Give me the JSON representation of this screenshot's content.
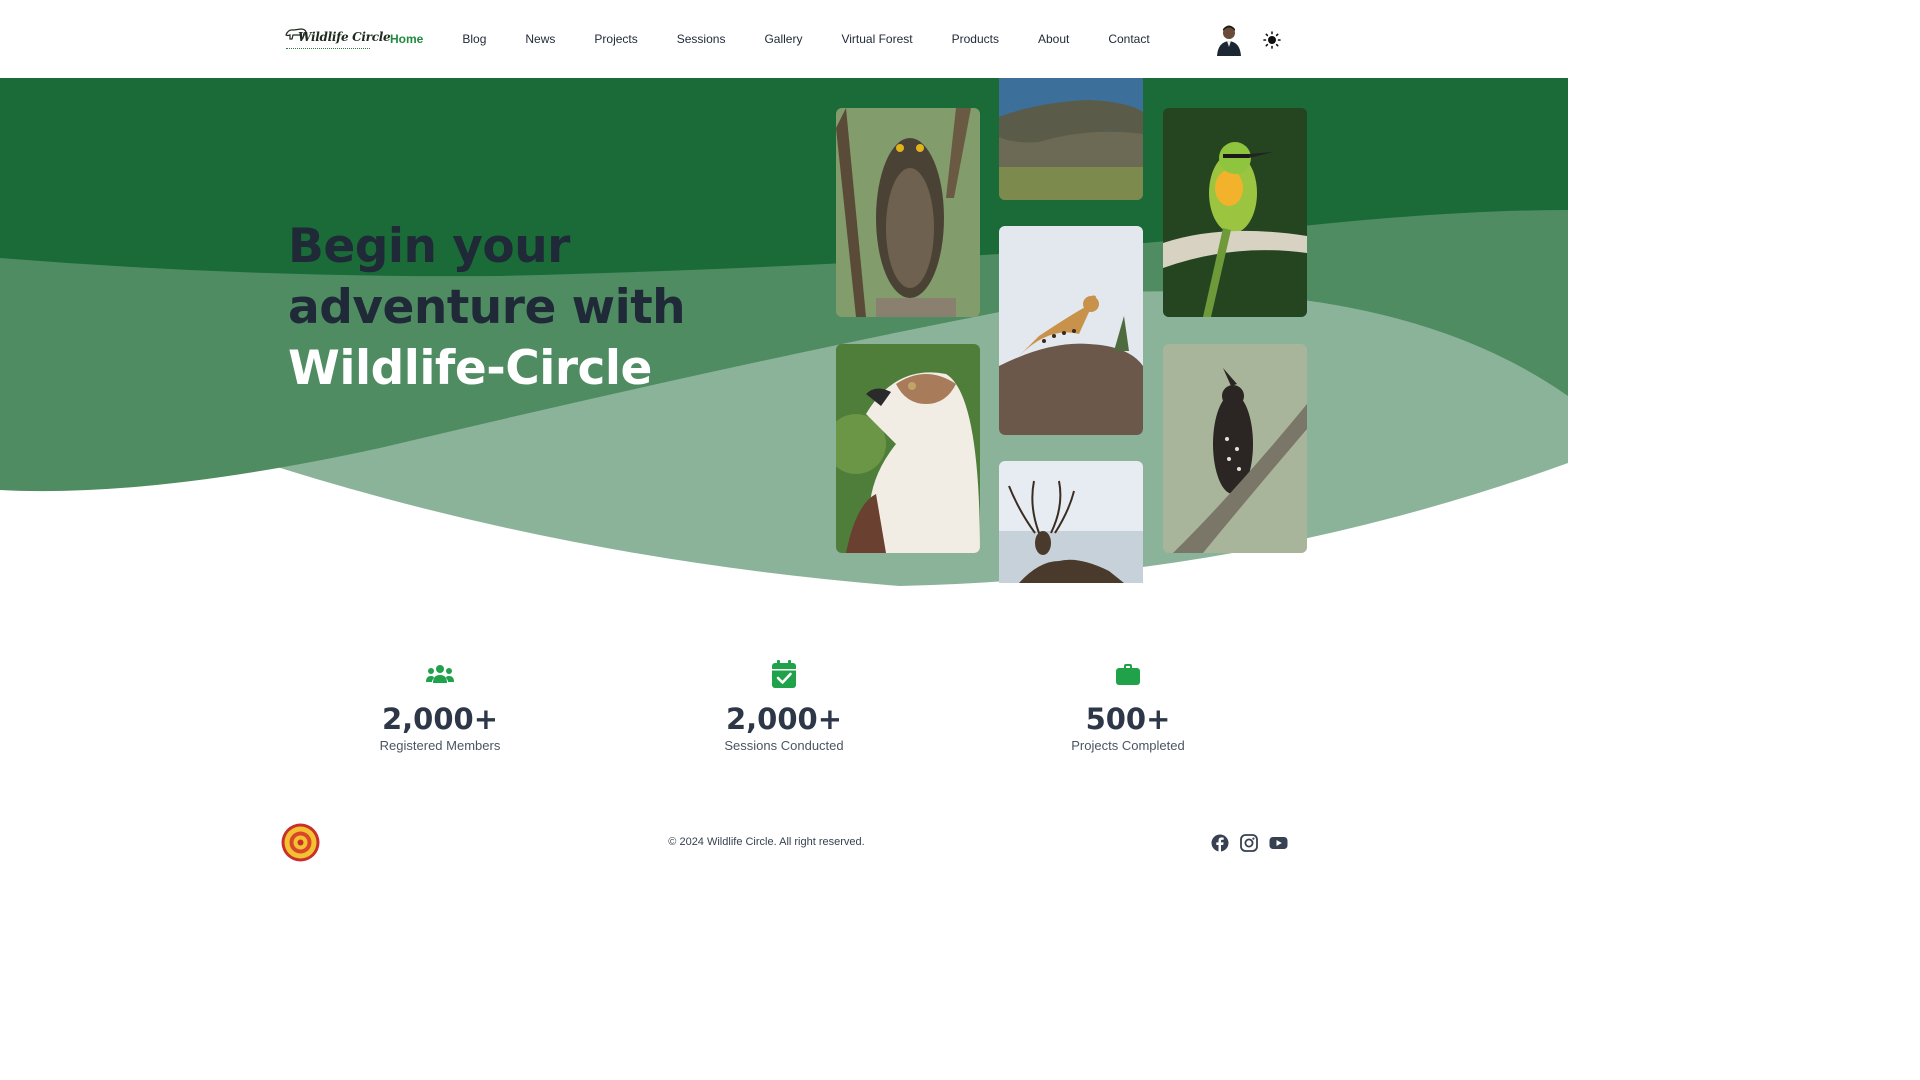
{
  "nav": {
    "logo_text": "Wildlife Circle",
    "items": [
      {
        "label": "Home",
        "active": true
      },
      {
        "label": "Blog"
      },
      {
        "label": "News"
      },
      {
        "label": "Projects"
      },
      {
        "label": "Sessions"
      },
      {
        "label": "Gallery"
      },
      {
        "label": "Virtual Forest"
      },
      {
        "label": "Products"
      },
      {
        "label": "About"
      },
      {
        "label": "Contact"
      }
    ],
    "avatar_icon": "user-avatar",
    "theme_toggle_icon": "sun-icon"
  },
  "hero": {
    "line1": "Begin your",
    "line2": "adventure with",
    "line3": "Wildlife-Circle",
    "photos": [
      "owl",
      "crocodile",
      "bee-eater",
      "leopard",
      "hawk-eagle",
      "deer",
      "crested-hawk-eagle"
    ]
  },
  "stats": [
    {
      "icon": "users-icon",
      "value": "2,000+",
      "label": "Registered Members"
    },
    {
      "icon": "calendar-check-icon",
      "value": "2,000+",
      "label": "Sessions Conducted"
    },
    {
      "icon": "briefcase-icon",
      "value": "500+",
      "label": "Projects Completed"
    }
  ],
  "footer": {
    "copyright": "© 2024 Wildlife Circle. All right reserved.",
    "social": [
      "facebook-icon",
      "instagram-icon",
      "youtube-icon"
    ]
  },
  "colors": {
    "accent": "#1f8a3e",
    "hero_dark": "#1a6b37",
    "hero_mid": "#4f8c62",
    "hero_light": "#8bb39a",
    "stat_icon": "#1fa24a"
  }
}
